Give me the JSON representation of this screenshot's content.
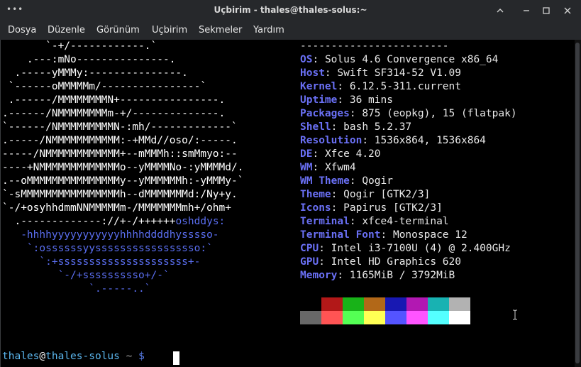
{
  "window": {
    "title": "Uçbirim - thales@thales-solus:~",
    "menu_icon": "dots-menu-icon",
    "buttons": {
      "scroll_up": "chevron-up-icon",
      "minimize": "minimize-icon",
      "maximize": "maximize-icon",
      "close": "close-icon"
    }
  },
  "menubar": {
    "items": [
      "Dosya",
      "Düzenle",
      "Görünüm",
      "Uçbirim",
      "Sekmeler",
      "Yardım"
    ]
  },
  "logo": {
    "lines": [
      "       `-+/------------.`",
      "    .---:mNo---------------.",
      "  .-----yMMMy:---------------.",
      " `------oMMMMMm/----------------`",
      " .------/MMMMMMMMN+----------------.",
      ".------/NMMMMMMMMm-+/--------------.",
      "`------/NMMMMMMMMMN-:mh/-------------`",
      ".-----/NMMMMMMMMMMM:-+MMd//oso/:-----.",
      "-----/NMMMMMMMMMMMM+--mMMMh::smMmyo:--",
      "----+NMMMMMMMMMMMMMo--yMMMMNo-:yMMMMd/.",
      ".--oMMMMMMMMMMMMMMMy--yMMMMMMh:-yMMMy-`",
      "`-sMMMMMMMMMMMMMMMMh--dMMMMMMMd:/Ny+y.",
      "`-/+osyhhdmmNNMMMMMm-/MMMMMMMmh+/ohm+",
      "  .-------------://+-/++++++"
    ],
    "line13_tail": "oshddys:",
    "blue_lines": [
      "   -hhhhyyyyyyyyyyyhhhhddddhysssso-",
      "    `:ossssssyysssssssssssssssso:`",
      "      `:+sssssssssssssssssssss+-",
      "         `-/+ssssssssso+/-`",
      "              `.-----..`"
    ]
  },
  "info": {
    "divider": "------------------------",
    "rows": [
      {
        "key": "OS",
        "value": "Solus 4.6 Convergence x86_64"
      },
      {
        "key": "Host",
        "value": "Swift SF314-52 V1.09"
      },
      {
        "key": "Kernel",
        "value": "6.12.5-311.current"
      },
      {
        "key": "Uptime",
        "value": "36 mins"
      },
      {
        "key": "Packages",
        "value": "875 (eopkg), 15 (flatpak)"
      },
      {
        "key": "Shell",
        "value": "bash 5.2.37"
      },
      {
        "key": "Resolution",
        "value": "1536x864, 1536x864"
      },
      {
        "key": "DE",
        "value": "Xfce 4.20"
      },
      {
        "key": "WM",
        "value": "Xfwm4"
      },
      {
        "key": "WM Theme",
        "value": "Qogir"
      },
      {
        "key": "Theme",
        "value": "Qogir [GTK2/3]"
      },
      {
        "key": "Icons",
        "value": "Papirus [GTK2/3]"
      },
      {
        "key": "Terminal",
        "value": "xfce4-terminal"
      },
      {
        "key": "Terminal Font",
        "value": "Monospace 12"
      },
      {
        "key": "CPU",
        "value": "Intel i3-7100U (4) @ 2.400GHz"
      },
      {
        "key": "GPU",
        "value": "Intel HD Graphics 620"
      },
      {
        "key": "Memory",
        "value": "1165MiB / 3792MiB"
      }
    ],
    "separator": ":"
  },
  "palette": {
    "row1": [
      "#000000",
      "#b21818",
      "#18b218",
      "#b26818",
      "#1818b2",
      "#b218b2",
      "#18b2b2",
      "#b2b2b2"
    ],
    "row2": [
      "#686868",
      "#ff5454",
      "#54ff54",
      "#ffff54",
      "#5454ff",
      "#ff54ff",
      "#54ffff",
      "#ffffff"
    ]
  },
  "prompt": {
    "user": "thales",
    "at": "@",
    "host": "thales-solus",
    "path": " ~ ",
    "dollar": "$"
  }
}
